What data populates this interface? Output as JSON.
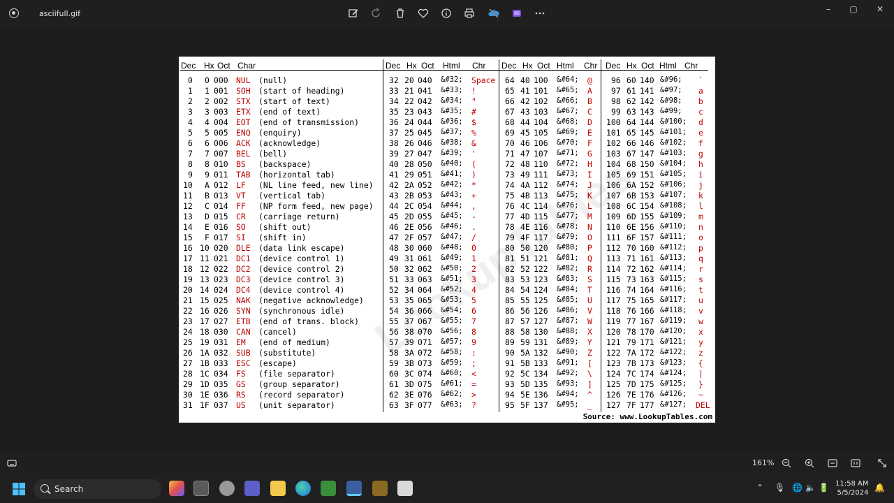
{
  "window": {
    "title": "asciifull.gif"
  },
  "toolbar": {
    "buttons": [
      "edit-icon",
      "rotate-icon",
      "delete-icon",
      "favorite-icon",
      "info-icon",
      "print-icon",
      "onedrive-icon",
      "clipchamp-icon",
      "more-icon"
    ]
  },
  "window_controls": {
    "minimize": "–",
    "maximize": "▢",
    "close": "✕"
  },
  "table": {
    "headers": {
      "g1": [
        "Dec",
        "Hx",
        "Oct",
        "Char"
      ],
      "g2": [
        "Dec",
        "Hx",
        "Oct",
        "Html",
        "Chr"
      ],
      "g3": [
        "Dec",
        "Hx",
        "Oct",
        "Html",
        "Chr"
      ],
      "g4": [
        "Dec",
        "Hx",
        "Oct",
        "Html",
        "Chr"
      ]
    },
    "control": [
      [
        "0",
        "0",
        "000",
        "NUL",
        "(null)"
      ],
      [
        "1",
        "1",
        "001",
        "SOH",
        "(start of heading)"
      ],
      [
        "2",
        "2",
        "002",
        "STX",
        "(start of text)"
      ],
      [
        "3",
        "3",
        "003",
        "ETX",
        "(end of text)"
      ],
      [
        "4",
        "4",
        "004",
        "EOT",
        "(end of transmission)"
      ],
      [
        "5",
        "5",
        "005",
        "ENQ",
        "(enquiry)"
      ],
      [
        "6",
        "6",
        "006",
        "ACK",
        "(acknowledge)"
      ],
      [
        "7",
        "7",
        "007",
        "BEL",
        "(bell)"
      ],
      [
        "8",
        "8",
        "010",
        "BS",
        "(backspace)"
      ],
      [
        "9",
        "9",
        "011",
        "TAB",
        "(horizontal tab)"
      ],
      [
        "10",
        "A",
        "012",
        "LF",
        "(NL line feed, new line)"
      ],
      [
        "11",
        "B",
        "013",
        "VT",
        "(vertical tab)"
      ],
      [
        "12",
        "C",
        "014",
        "FF",
        "(NP form feed, new page)"
      ],
      [
        "13",
        "D",
        "015",
        "CR",
        "(carriage return)"
      ],
      [
        "14",
        "E",
        "016",
        "SO",
        "(shift out)"
      ],
      [
        "15",
        "F",
        "017",
        "SI",
        "(shift in)"
      ],
      [
        "16",
        "10",
        "020",
        "DLE",
        "(data link escape)"
      ],
      [
        "17",
        "11",
        "021",
        "DC1",
        "(device control 1)"
      ],
      [
        "18",
        "12",
        "022",
        "DC2",
        "(device control 2)"
      ],
      [
        "19",
        "13",
        "023",
        "DC3",
        "(device control 3)"
      ],
      [
        "20",
        "14",
        "024",
        "DC4",
        "(device control 4)"
      ],
      [
        "21",
        "15",
        "025",
        "NAK",
        "(negative acknowledge)"
      ],
      [
        "22",
        "16",
        "026",
        "SYN",
        "(synchronous idle)"
      ],
      [
        "23",
        "17",
        "027",
        "ETB",
        "(end of trans. block)"
      ],
      [
        "24",
        "18",
        "030",
        "CAN",
        "(cancel)"
      ],
      [
        "25",
        "19",
        "031",
        "EM",
        "(end of medium)"
      ],
      [
        "26",
        "1A",
        "032",
        "SUB",
        "(substitute)"
      ],
      [
        "27",
        "1B",
        "033",
        "ESC",
        "(escape)"
      ],
      [
        "28",
        "1C",
        "034",
        "FS",
        "(file separator)"
      ],
      [
        "29",
        "1D",
        "035",
        "GS",
        "(group separator)"
      ],
      [
        "30",
        "1E",
        "036",
        "RS",
        "(record separator)"
      ],
      [
        "31",
        "1F",
        "037",
        "US",
        "(unit separator)"
      ]
    ],
    "g2": [
      [
        "32",
        "20",
        "040",
        "&#32;",
        "Space"
      ],
      [
        "33",
        "21",
        "041",
        "&#33;",
        "!"
      ],
      [
        "34",
        "22",
        "042",
        "&#34;",
        "\""
      ],
      [
        "35",
        "23",
        "043",
        "&#35;",
        "#"
      ],
      [
        "36",
        "24",
        "044",
        "&#36;",
        "$"
      ],
      [
        "37",
        "25",
        "045",
        "&#37;",
        "%"
      ],
      [
        "38",
        "26",
        "046",
        "&#38;",
        "&"
      ],
      [
        "39",
        "27",
        "047",
        "&#39;",
        "'"
      ],
      [
        "40",
        "28",
        "050",
        "&#40;",
        "("
      ],
      [
        "41",
        "29",
        "051",
        "&#41;",
        ")"
      ],
      [
        "42",
        "2A",
        "052",
        "&#42;",
        "*"
      ],
      [
        "43",
        "2B",
        "053",
        "&#43;",
        "+"
      ],
      [
        "44",
        "2C",
        "054",
        "&#44;",
        ","
      ],
      [
        "45",
        "2D",
        "055",
        "&#45;",
        "-"
      ],
      [
        "46",
        "2E",
        "056",
        "&#46;",
        "."
      ],
      [
        "47",
        "2F",
        "057",
        "&#47;",
        "/"
      ],
      [
        "48",
        "30",
        "060",
        "&#48;",
        "0"
      ],
      [
        "49",
        "31",
        "061",
        "&#49;",
        "1"
      ],
      [
        "50",
        "32",
        "062",
        "&#50;",
        "2"
      ],
      [
        "51",
        "33",
        "063",
        "&#51;",
        "3"
      ],
      [
        "52",
        "34",
        "064",
        "&#52;",
        "4"
      ],
      [
        "53",
        "35",
        "065",
        "&#53;",
        "5"
      ],
      [
        "54",
        "36",
        "066",
        "&#54;",
        "6"
      ],
      [
        "55",
        "37",
        "067",
        "&#55;",
        "7"
      ],
      [
        "56",
        "38",
        "070",
        "&#56;",
        "8"
      ],
      [
        "57",
        "39",
        "071",
        "&#57;",
        "9"
      ],
      [
        "58",
        "3A",
        "072",
        "&#58;",
        ":"
      ],
      [
        "59",
        "3B",
        "073",
        "&#59;",
        ";"
      ],
      [
        "60",
        "3C",
        "074",
        "&#60;",
        "<"
      ],
      [
        "61",
        "3D",
        "075",
        "&#61;",
        "="
      ],
      [
        "62",
        "3E",
        "076",
        "&#62;",
        ">"
      ],
      [
        "63",
        "3F",
        "077",
        "&#63;",
        "?"
      ]
    ],
    "g3": [
      [
        "64",
        "40",
        "100",
        "&#64;",
        "@"
      ],
      [
        "65",
        "41",
        "101",
        "&#65;",
        "A"
      ],
      [
        "66",
        "42",
        "102",
        "&#66;",
        "B"
      ],
      [
        "67",
        "43",
        "103",
        "&#67;",
        "C"
      ],
      [
        "68",
        "44",
        "104",
        "&#68;",
        "D"
      ],
      [
        "69",
        "45",
        "105",
        "&#69;",
        "E"
      ],
      [
        "70",
        "46",
        "106",
        "&#70;",
        "F"
      ],
      [
        "71",
        "47",
        "107",
        "&#71;",
        "G"
      ],
      [
        "72",
        "48",
        "110",
        "&#72;",
        "H"
      ],
      [
        "73",
        "49",
        "111",
        "&#73;",
        "I"
      ],
      [
        "74",
        "4A",
        "112",
        "&#74;",
        "J"
      ],
      [
        "75",
        "4B",
        "113",
        "&#75;",
        "K"
      ],
      [
        "76",
        "4C",
        "114",
        "&#76;",
        "L"
      ],
      [
        "77",
        "4D",
        "115",
        "&#77;",
        "M"
      ],
      [
        "78",
        "4E",
        "116",
        "&#78;",
        "N"
      ],
      [
        "79",
        "4F",
        "117",
        "&#79;",
        "O"
      ],
      [
        "80",
        "50",
        "120",
        "&#80;",
        "P"
      ],
      [
        "81",
        "51",
        "121",
        "&#81;",
        "Q"
      ],
      [
        "82",
        "52",
        "122",
        "&#82;",
        "R"
      ],
      [
        "83",
        "53",
        "123",
        "&#83;",
        "S"
      ],
      [
        "84",
        "54",
        "124",
        "&#84;",
        "T"
      ],
      [
        "85",
        "55",
        "125",
        "&#85;",
        "U"
      ],
      [
        "86",
        "56",
        "126",
        "&#86;",
        "V"
      ],
      [
        "87",
        "57",
        "127",
        "&#87;",
        "W"
      ],
      [
        "88",
        "58",
        "130",
        "&#88;",
        "X"
      ],
      [
        "89",
        "59",
        "131",
        "&#89;",
        "Y"
      ],
      [
        "90",
        "5A",
        "132",
        "&#90;",
        "Z"
      ],
      [
        "91",
        "5B",
        "133",
        "&#91;",
        "["
      ],
      [
        "92",
        "5C",
        "134",
        "&#92;",
        "\\"
      ],
      [
        "93",
        "5D",
        "135",
        "&#93;",
        "]"
      ],
      [
        "94",
        "5E",
        "136",
        "&#94;",
        "^"
      ],
      [
        "95",
        "5F",
        "137",
        "&#95;",
        "_"
      ]
    ],
    "g4": [
      [
        "96",
        "60",
        "140",
        "&#96;",
        "`"
      ],
      [
        "97",
        "61",
        "141",
        "&#97;",
        "a"
      ],
      [
        "98",
        "62",
        "142",
        "&#98;",
        "b"
      ],
      [
        "99",
        "63",
        "143",
        "&#99;",
        "c"
      ],
      [
        "100",
        "64",
        "144",
        "&#100;",
        "d"
      ],
      [
        "101",
        "65",
        "145",
        "&#101;",
        "e"
      ],
      [
        "102",
        "66",
        "146",
        "&#102;",
        "f"
      ],
      [
        "103",
        "67",
        "147",
        "&#103;",
        "g"
      ],
      [
        "104",
        "68",
        "150",
        "&#104;",
        "h"
      ],
      [
        "105",
        "69",
        "151",
        "&#105;",
        "i"
      ],
      [
        "106",
        "6A",
        "152",
        "&#106;",
        "j"
      ],
      [
        "107",
        "6B",
        "153",
        "&#107;",
        "k"
      ],
      [
        "108",
        "6C",
        "154",
        "&#108;",
        "l"
      ],
      [
        "109",
        "6D",
        "155",
        "&#109;",
        "m"
      ],
      [
        "110",
        "6E",
        "156",
        "&#110;",
        "n"
      ],
      [
        "111",
        "6F",
        "157",
        "&#111;",
        "o"
      ],
      [
        "112",
        "70",
        "160",
        "&#112;",
        "p"
      ],
      [
        "113",
        "71",
        "161",
        "&#113;",
        "q"
      ],
      [
        "114",
        "72",
        "162",
        "&#114;",
        "r"
      ],
      [
        "115",
        "73",
        "163",
        "&#115;",
        "s"
      ],
      [
        "116",
        "74",
        "164",
        "&#116;",
        "t"
      ],
      [
        "117",
        "75",
        "165",
        "&#117;",
        "u"
      ],
      [
        "118",
        "76",
        "166",
        "&#118;",
        "v"
      ],
      [
        "119",
        "77",
        "167",
        "&#119;",
        "w"
      ],
      [
        "120",
        "78",
        "170",
        "&#120;",
        "x"
      ],
      [
        "121",
        "79",
        "171",
        "&#121;",
        "y"
      ],
      [
        "122",
        "7A",
        "172",
        "&#122;",
        "z"
      ],
      [
        "123",
        "7B",
        "173",
        "&#123;",
        "{"
      ],
      [
        "124",
        "7C",
        "174",
        "&#124;",
        "|"
      ],
      [
        "125",
        "7D",
        "175",
        "&#125;",
        "}"
      ],
      [
        "126",
        "7E",
        "176",
        "&#126;",
        "~"
      ],
      [
        "127",
        "7F",
        "177",
        "&#127;",
        "DEL"
      ]
    ],
    "source": "Source:  www.LookupTables.com",
    "watermark": "LookupTables"
  },
  "statusbar": {
    "zoom": "161%"
  },
  "taskbar": {
    "search_placeholder": "Search",
    "time": "11:58 AM",
    "date": "5/5/2024"
  },
  "colors": {
    "accent_red": "#c00000",
    "taskbar": "#202020",
    "viewer_bg": "#1d1d1d"
  }
}
